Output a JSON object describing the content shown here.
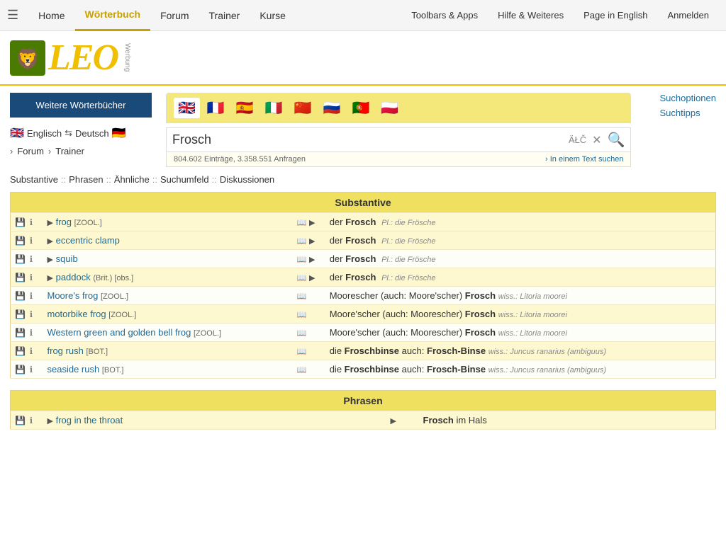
{
  "nav": {
    "hamburger": "☰",
    "items": [
      {
        "label": "Home",
        "active": false
      },
      {
        "label": "Wörterbuch",
        "active": true
      },
      {
        "label": "Forum",
        "active": false
      },
      {
        "label": "Trainer",
        "active": false
      },
      {
        "label": "Kurse",
        "active": false
      }
    ],
    "right_items": [
      {
        "label": "Toolbars & Apps"
      },
      {
        "label": "Hilfe & Weiteres"
      },
      {
        "label": "Page in English"
      },
      {
        "label": "Anmelden"
      }
    ]
  },
  "logo": {
    "lion_emoji": "🦁",
    "text": "LEO",
    "werbung": "Werbung"
  },
  "sidebar": {
    "dict_btn": "Weitere Wörterbücher",
    "lang_from": "Englisch",
    "lang_to": "Deutsch",
    "forum": "Forum",
    "trainer": "Trainer"
  },
  "search": {
    "flags": [
      "🇬🇧",
      "🇫🇷",
      "🇪🇸",
      "🇮🇹",
      "🇨🇳",
      "🇷🇺",
      "🇵🇹",
      "🇵🇱"
    ],
    "value": "Frosch",
    "atc_label": "ÄŁČ",
    "clear": "✕",
    "search_icon": "🔍",
    "stats": "804.602 Einträge, 3.358.551 Anfragen",
    "text_search": "› In einem Text suchen",
    "suchoptionen": "Suchoptionen",
    "suchtipps": "Suchtipps"
  },
  "result_tabs": {
    "items": [
      "Substantive",
      "Phrasen",
      "Ähnliche",
      "Suchumfeld",
      "Diskussionen"
    ],
    "sep": " :: "
  },
  "substantive_section": {
    "header": "Substantive",
    "rows": [
      {
        "highlight": true,
        "en_play": true,
        "en_book": true,
        "en_text": "frog",
        "en_tag": "[ZOOL.]",
        "de_book": true,
        "de_play": true,
        "de_article": "der",
        "de_word": "Frosch",
        "de_pl": "Pl.: die Frösche"
      },
      {
        "highlight": true,
        "en_play": true,
        "en_book": true,
        "en_text": "eccentric clamp",
        "de_book": true,
        "de_play": true,
        "de_article": "der",
        "de_word": "Frosch",
        "de_pl": "Pl.: die Frösche"
      },
      {
        "highlight": false,
        "en_play": true,
        "en_book": true,
        "en_text": "squib",
        "de_book": true,
        "de_play": true,
        "de_article": "der",
        "de_word": "Frosch",
        "de_pl": "Pl.: die Frösche"
      },
      {
        "highlight": true,
        "en_play": true,
        "en_book": true,
        "en_text": "paddock",
        "en_tag": "(Brit.) [obs.]",
        "de_book": true,
        "de_play": true,
        "de_article": "der",
        "de_word": "Frosch",
        "de_pl": "Pl.: die Frösche"
      },
      {
        "highlight": false,
        "en_text": "Moore's frog",
        "en_tag": "[ZOOL.]",
        "de_book": true,
        "de_pre": "Moorescher (auch: Moore'scher)",
        "de_word": "Frosch",
        "de_wiss": "wiss.: Litoria moorei"
      },
      {
        "highlight": true,
        "en_text": "motorbike frog",
        "en_tag": "[ZOOL.]",
        "de_book": true,
        "de_pre": "Moore'scher (auch: Moorescher)",
        "de_word": "Frosch",
        "de_wiss": "wiss.: Litoria moorei"
      },
      {
        "highlight": false,
        "en_text": "Western green and golden bell frog",
        "en_tag": "[ZOOL.]",
        "de_book": true,
        "de_pre": "Moore'scher (auch: Moorescher)",
        "de_word": "Frosch",
        "de_wiss": "wiss.: Litoria moorei"
      },
      {
        "highlight": true,
        "en_text": "frog rush",
        "en_tag": "[BOT.]",
        "de_book": true,
        "de_article": "die",
        "de_word": "Froschbinse",
        "de_also": "auch:",
        "de_also_word": "Frosch-Binse",
        "de_wiss": "wiss.: Juncus ranarius (ambiguus)"
      },
      {
        "highlight": false,
        "en_text": "seaside rush",
        "en_tag": "[BOT.]",
        "de_book": true,
        "de_article": "die",
        "de_word": "Froschbinse",
        "de_also": "auch:",
        "de_also_word": "Frosch-Binse",
        "de_wiss": "wiss.: Juncus ranarius (ambiguus)"
      }
    ]
  },
  "phrasen_section": {
    "header": "Phrasen",
    "rows": [
      {
        "highlight": true,
        "en_play": true,
        "en_text": "frog in the throat",
        "de_play": true,
        "de_word": "Frosch",
        "de_rest": " im Hals"
      }
    ]
  }
}
